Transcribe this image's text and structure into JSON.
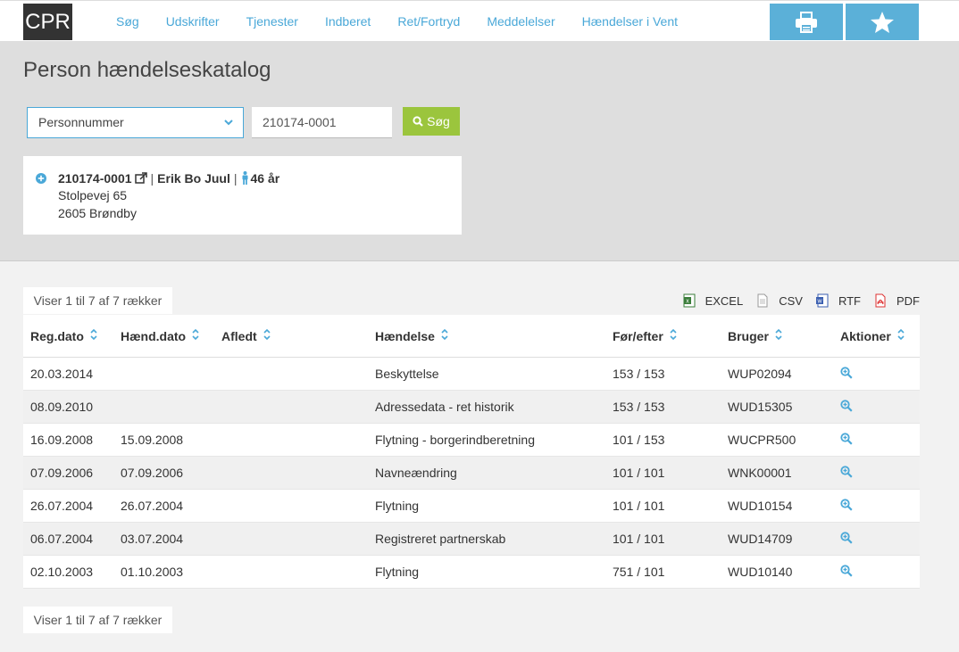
{
  "app": {
    "logo": "CPR"
  },
  "nav": {
    "links": [
      "Søg",
      "Udskrifter",
      "Tjenester",
      "Indberet",
      "Ret/Fortryd",
      "Meddelelser",
      "Hændelser i Vent"
    ],
    "print_icon": "print-icon",
    "star_icon": "star-icon"
  },
  "page": {
    "title": "Person hændelseskatalog"
  },
  "search": {
    "type_selected": "Personnummer",
    "value": "210174-0001",
    "button_label": "Søg"
  },
  "person": {
    "cpr": "210174-0001",
    "name": "Erik Bo Juul",
    "age": "46 år",
    "street": "Stolpevej 65",
    "city": "2605 Brøndby"
  },
  "table_info": {
    "top": "Viser 1 til 7 af 7 rækker",
    "bottom": "Viser 1 til 7 af 7 rækker"
  },
  "exports": [
    "EXCEL",
    "CSV",
    "RTF",
    "PDF"
  ],
  "table": {
    "columns": [
      "Reg.dato",
      "Hænd.dato",
      "Afledt",
      "Hændelse",
      "Før/efter",
      "Bruger",
      "Aktioner"
    ],
    "rows": [
      [
        "20.03.2014",
        "",
        "",
        "Beskyttelse",
        "153 / 153",
        "WUP02094"
      ],
      [
        "08.09.2010",
        "",
        "",
        "Adressedata - ret historik",
        "153 / 153",
        "WUD15305"
      ],
      [
        "16.09.2008",
        "15.09.2008",
        "",
        "Flytning - borgerindberetning",
        "101 / 153",
        "WUCPR500"
      ],
      [
        "07.09.2006",
        "07.09.2006",
        "",
        "Navneændring",
        "101 / 101",
        "WNK00001"
      ],
      [
        "26.07.2004",
        "26.07.2004",
        "",
        "Flytning",
        "101 / 101",
        "WUD10154"
      ],
      [
        "06.07.2004",
        "03.07.2004",
        "",
        "Registreret partnerskab",
        "101 / 101",
        "WUD14709"
      ],
      [
        "02.10.2003",
        "01.10.2003",
        "",
        "Flytning",
        "751 / 101",
        "WUD10140"
      ]
    ]
  },
  "colors": {
    "accent": "#4aa8d8",
    "search_button": "#9bc53d",
    "nav_button": "#5bb0d8"
  }
}
